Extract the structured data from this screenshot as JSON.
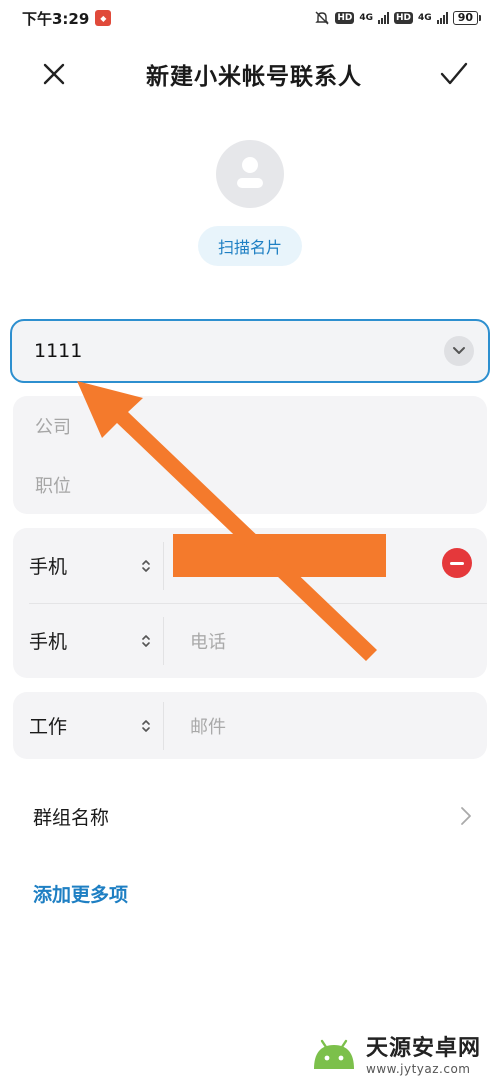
{
  "status_bar": {
    "time": "下午3:29",
    "hd1": "HD",
    "net1": "4G",
    "hd2": "HD",
    "net2": "4G",
    "battery": "90"
  },
  "header": {
    "title": "新建小米帐号联系人"
  },
  "avatar": {
    "scan_label": "扫描名片"
  },
  "form": {
    "name_value": "1111",
    "company_placeholder": "公司",
    "position_placeholder": "职位",
    "phones": [
      {
        "type": "手机",
        "value": ""
      },
      {
        "type": "手机",
        "placeholder": "电话"
      }
    ],
    "email": {
      "type": "工作",
      "placeholder": "邮件"
    },
    "group_label": "群组名称",
    "add_more_label": "添加更多项"
  },
  "watermark": {
    "title": "天源安卓网",
    "url": "www.jytyaz.com"
  },
  "colors": {
    "accent": "#1e7fc3",
    "annotation": "#f47a2c",
    "remove": "#e5383b"
  }
}
